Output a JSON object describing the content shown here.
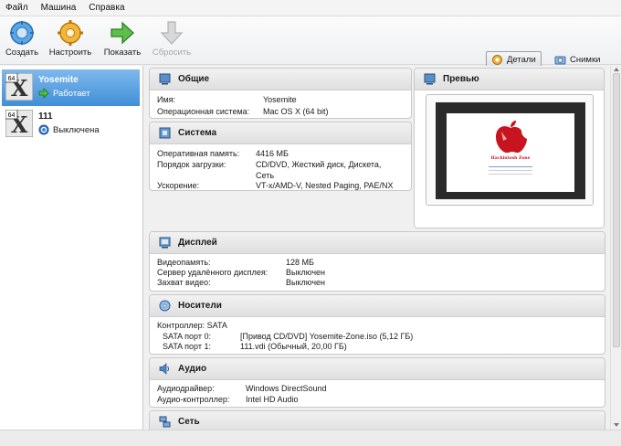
{
  "menu": {
    "items": [
      "Файл",
      "Машина",
      "Справка"
    ]
  },
  "toolbar": {
    "create": "Создать",
    "settings": "Настроить",
    "show": "Показать",
    "discard": "Сбросить",
    "details": "Детали",
    "snapshots": "Снимки"
  },
  "vms": [
    {
      "name": "Yosemite",
      "state": "Работает",
      "os_badge": "64"
    },
    {
      "name": "111",
      "state": "Выключена",
      "os_badge": "64"
    }
  ],
  "general": {
    "title": "Общие",
    "name_label": "Имя:",
    "name_value": "Yosemite",
    "os_label": "Операционная система:",
    "os_value": "Mac OS X (64 bit)"
  },
  "system": {
    "title": "Система",
    "ram_label": "Оперативная память:",
    "ram_value": "4416 МБ",
    "boot_label": "Порядок загрузки:",
    "boot_value_1": "CD/DVD, Жесткий диск, Дискета,",
    "boot_value_2": "Сеть",
    "accel_label": "Ускорение:",
    "accel_value": "VT-x/AMD-V, Nested Paging, PAE/NX"
  },
  "preview": {
    "title": "Превью",
    "screen_text": "Hackintosh Zone"
  },
  "display": {
    "title": "Дисплей",
    "vram_label": "Видеопамять:",
    "vram_value": "128 МБ",
    "rdp_label": "Сервер удалённого дисплея:",
    "rdp_value": "Выключен",
    "capture_label": "Захват видео:",
    "capture_value": "Выключен"
  },
  "storage": {
    "title": "Носители",
    "controller": "Контроллер: SATA",
    "port0_label": "SATA порт 0:",
    "port0_value": "[Привод CD/DVD] Yosemite-Zone.iso (5,12 ГБ)",
    "port1_label": "SATA порт 1:",
    "port1_value": "111.vdi (Обычный, 20,00 ГБ)"
  },
  "audio": {
    "title": "Аудио",
    "driver_label": "Аудиодрайвер:",
    "driver_value": "Windows DirectSound",
    "controller_label": "Аудио-контроллер:",
    "controller_value": "Intel HD Audio"
  },
  "network": {
    "title": "Сеть"
  },
  "colors": {
    "selected": "#3f8fd8",
    "running": "#3aa63a",
    "accent_red": "#c8141e"
  }
}
